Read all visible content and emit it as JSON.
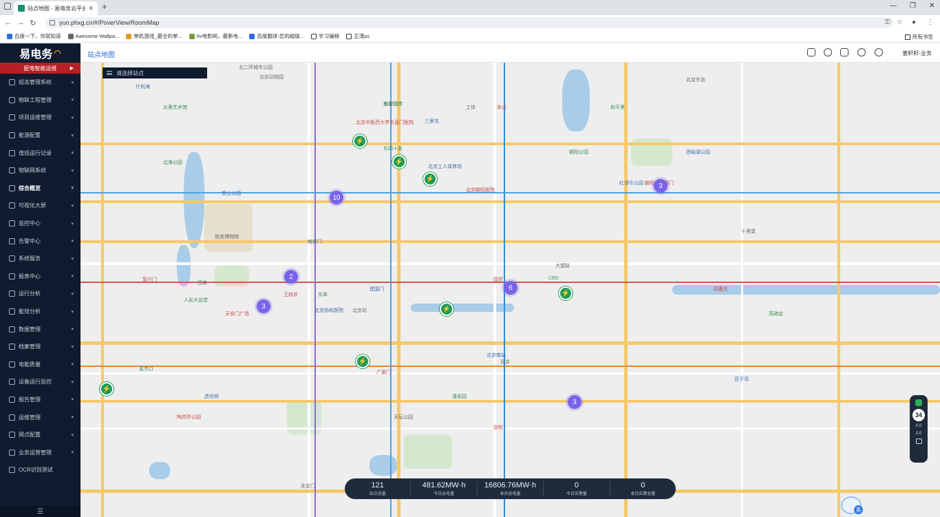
{
  "browser": {
    "tab_title": "站点地图 - 易电务云平台",
    "tab_close": "✕",
    "new_tab": "+",
    "url": "yun.phxg.cn/#/PoverView/RoomMap",
    "window_controls": [
      "—",
      "❐",
      "✕"
    ],
    "nav": [
      "←",
      "→",
      "↻"
    ],
    "bookmarks": [
      {
        "label": "百度一下，你就知道",
        "color": "#2f6ae0"
      },
      {
        "label": "Awesome Wallpa...",
        "color": "#666666"
      },
      {
        "label": "单机游戏_最全的单...",
        "color": "#e59b1c"
      },
      {
        "label": "6v电影网，最新电...",
        "color": "#7a9b3a"
      },
      {
        "label": "百度翻译-您的超级...",
        "color": "#2f6ae0"
      },
      {
        "label": "学习编程",
        "color": "#333333"
      },
      {
        "label": "王涛ps",
        "color": "#333333"
      }
    ],
    "all_bookmarks": "所有书签"
  },
  "sidebar": {
    "logo": "易电务",
    "active_group": "配电智能运维",
    "items": [
      {
        "label": "组态管理系统",
        "icon": "sliders-icon"
      },
      {
        "label": "物联工程管理",
        "icon": "box-icon"
      },
      {
        "label": "项目运维管理",
        "icon": "settings-icon"
      },
      {
        "label": "能源配置",
        "icon": "globe-icon"
      },
      {
        "label": "值班运行记录",
        "icon": "clock-icon"
      },
      {
        "label": "物联网系统",
        "icon": "leaf-icon"
      },
      {
        "label": "综合概览",
        "icon": "monitor-icon",
        "bold": true
      },
      {
        "label": "可视化大屏",
        "icon": "tv-icon"
      },
      {
        "label": "监控中心",
        "icon": "bolt-icon"
      },
      {
        "label": "告警中心",
        "icon": "bell-icon"
      },
      {
        "label": "系统服务",
        "icon": "table-icon"
      },
      {
        "label": "报表中心",
        "icon": "chart-icon"
      },
      {
        "label": "运行分析",
        "icon": "pulse-icon"
      },
      {
        "label": "能效分析",
        "icon": "gauge-icon"
      },
      {
        "label": "数据管理",
        "icon": "database-icon"
      },
      {
        "label": "档案管理",
        "icon": "archive-icon"
      },
      {
        "label": "电能质量",
        "icon": "meter-icon"
      },
      {
        "label": "设备运行监控",
        "icon": "device-icon"
      },
      {
        "label": "报告管理",
        "icon": "report-icon"
      },
      {
        "label": "运维管理",
        "icon": "wrench-icon"
      },
      {
        "label": "网点配置",
        "icon": "grid-icon"
      },
      {
        "label": "业务运营管理",
        "icon": "briefcase-icon"
      },
      {
        "label": "OCR识别测试",
        "icon": "scan-icon"
      }
    ],
    "collapse_icon": "☰"
  },
  "header": {
    "title": "站点地图",
    "user": "姜轩轩-业务"
  },
  "map": {
    "search_placeholder": "请选择站点",
    "clusters": [
      "10",
      "2",
      "3",
      "6",
      "3",
      "3"
    ],
    "pois": [
      "北二环城市公园",
      "北京中医药大学东直门医院",
      "东四十条",
      "北京工人体育场",
      "东直门",
      "北京朝阳医院",
      "朝阳公园",
      "红领巾公园",
      "北京东站",
      "王府井",
      "东单",
      "建国门",
      "北京站",
      "国贸",
      "CBD",
      "北京南站",
      "天坛公园",
      "陶然亭公园",
      "北海公园",
      "景山公园",
      "故宫博物院",
      "天安门广场",
      "人民大会堂",
      "北京协和医院",
      "双井",
      "劲松",
      "潘家园",
      "团结湖公园",
      "十里堡",
      "四惠东",
      "高碑店",
      "百子湾",
      "大望路",
      "广渠门",
      "南锣鼓巷",
      "地安门",
      "西单",
      "复兴门",
      "菜市口",
      "虎坊桥",
      "永定门",
      "安贞",
      "和平里",
      "三里屯",
      "工体",
      "朝阳公园西门",
      "炎黄艺术馆",
      "什刹海",
      "北京动物园"
    ],
    "stats": [
      {
        "value": "121",
        "label": "站点总量"
      },
      {
        "value": "481.62MW·h",
        "label": "今日总电量"
      },
      {
        "value": "16806.76MW·h",
        "label": "本月总电量"
      },
      {
        "value": "0",
        "label": "今日告警量"
      },
      {
        "value": "0",
        "label": "本月告警总量"
      }
    ],
    "weather": {
      "temp": "34",
      "line1": "0.0",
      "line2": "0.0"
    },
    "lang_badge": "英"
  }
}
